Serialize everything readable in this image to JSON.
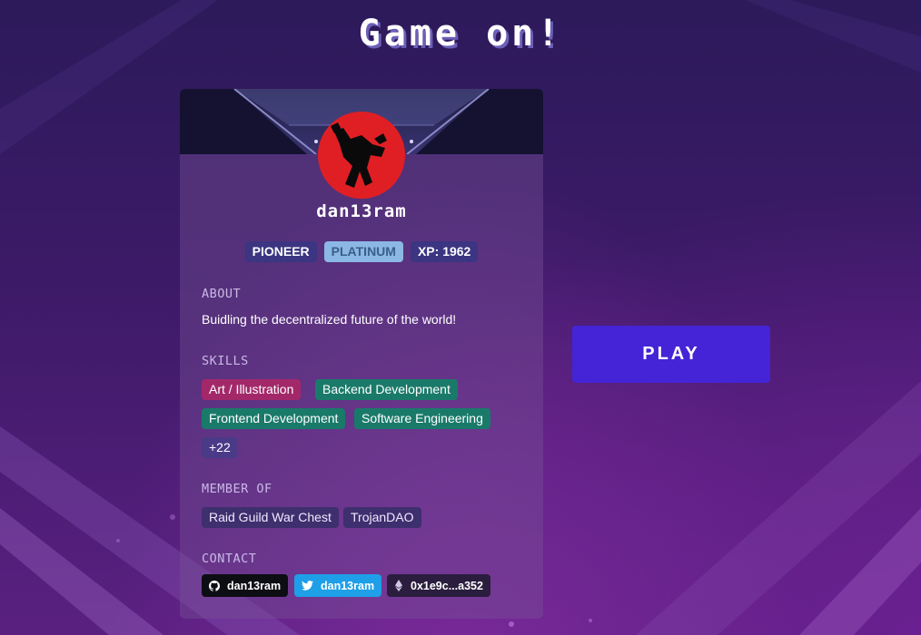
{
  "page": {
    "title": "Game on!"
  },
  "profile": {
    "username": "dan13ram",
    "badges": {
      "pioneer": "PIONEER",
      "tier": "PLATINUM",
      "xp": "XP: 1962"
    },
    "about": {
      "label": "ABOUT",
      "text": "Buidling the decentralized future of the world!"
    },
    "skills": {
      "label": "SKILLS",
      "items": [
        "Art / Illustration",
        "Backend Development",
        "Frontend Development",
        "Software Engineering"
      ],
      "more": "+22"
    },
    "member_of": {
      "label": "MEMBER OF",
      "items": [
        "Raid Guild War Chest",
        "TrojanDAO"
      ]
    },
    "contact": {
      "label": "CONTACT",
      "github": "dan13ram",
      "twitter": "dan13ram",
      "eth": "0x1e9c...a352"
    }
  },
  "actions": {
    "play": "PLAY"
  },
  "colors": {
    "accent": "#4424d6",
    "avatar_bg": "#e01f24",
    "tier_badge": "#8bb8e4",
    "skill_pink": "#a3286a",
    "skill_teal": "#1a7a6a",
    "twitter": "#1e9fe8"
  }
}
